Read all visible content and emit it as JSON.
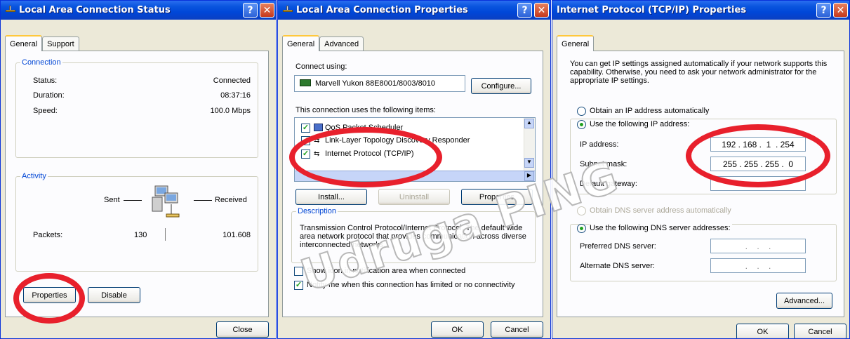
{
  "status_window": {
    "title": "Local Area Connection Status",
    "tabs": [
      "General",
      "Support"
    ],
    "connection": {
      "legend": "Connection",
      "status_label": "Status:",
      "status_value": "Connected",
      "duration_label": "Duration:",
      "duration_value": "08:37:16",
      "speed_label": "Speed:",
      "speed_value": "100.0 Mbps"
    },
    "activity": {
      "legend": "Activity",
      "sent_label": "Sent",
      "received_label": "Received",
      "packets_label": "Packets:",
      "packets_sent": "130",
      "packets_received": "101.608"
    },
    "buttons": {
      "properties": "Properties",
      "disable": "Disable",
      "close": "Close"
    }
  },
  "properties_window": {
    "title": "Local Area Connection Properties",
    "tabs": [
      "General",
      "Advanced"
    ],
    "connect_using_label": "Connect using:",
    "adapter_name": "Marvell Yukon 88E8001/8003/8010",
    "configure_button": "Configure...",
    "items_label": "This connection uses the following items:",
    "items": [
      {
        "label": "QoS Packet Scheduler",
        "checked": true
      },
      {
        "label": "Link-Layer Topology Discovery Responder",
        "checked": true
      },
      {
        "label": "Internet Protocol (TCP/IP)",
        "checked": true
      }
    ],
    "buttons": {
      "install": "Install...",
      "uninstall": "Uninstall",
      "properties": "Properties",
      "ok": "OK",
      "cancel": "Cancel"
    },
    "description_legend": "Description",
    "description_text": "Transmission Control Protocol/Internet Protocol. The default wide area network protocol that provides communication across diverse interconnected networks.",
    "show_icon_label": "Show icon in notification area when connected",
    "notify_label": "Notify me when this connection has limited or no connectivity",
    "show_icon_checked": false,
    "notify_checked": true
  },
  "tcpip_window": {
    "title": "Internet Protocol (TCP/IP) Properties",
    "tab": "General",
    "intro": "You can get IP settings assigned automatically if your network supports this capability. Otherwise, you need to ask your network administrator for the appropriate IP settings.",
    "obtain_ip_auto": "Obtain an IP address automatically",
    "use_following_ip": "Use the following IP address:",
    "ip_address_label": "IP address:",
    "ip_address_value": "192 . 168 .  1  . 254",
    "subnet_mask_label": "Subnet mask:",
    "subnet_mask_value": "255 . 255 . 255 .  0",
    "default_gateway_label": "Default gateway:",
    "default_gateway_value": ".    .    .",
    "obtain_dns_auto": "Obtain DNS server address automatically",
    "use_following_dns": "Use the following DNS server addresses:",
    "preferred_dns_label": "Preferred DNS server:",
    "preferred_dns_value": ".    .    .",
    "alternate_dns_label": "Alternate DNS server:",
    "alternate_dns_value": ".    .    .",
    "buttons": {
      "advanced": "Advanced...",
      "ok": "OK",
      "cancel": "Cancel"
    }
  },
  "watermark": "Udruga PING",
  "colors": {
    "title_bar": "#0a55de",
    "dialog_bg": "#ece9d8",
    "group_legend": "#0046d5",
    "annotation_red": "#e8202c"
  }
}
